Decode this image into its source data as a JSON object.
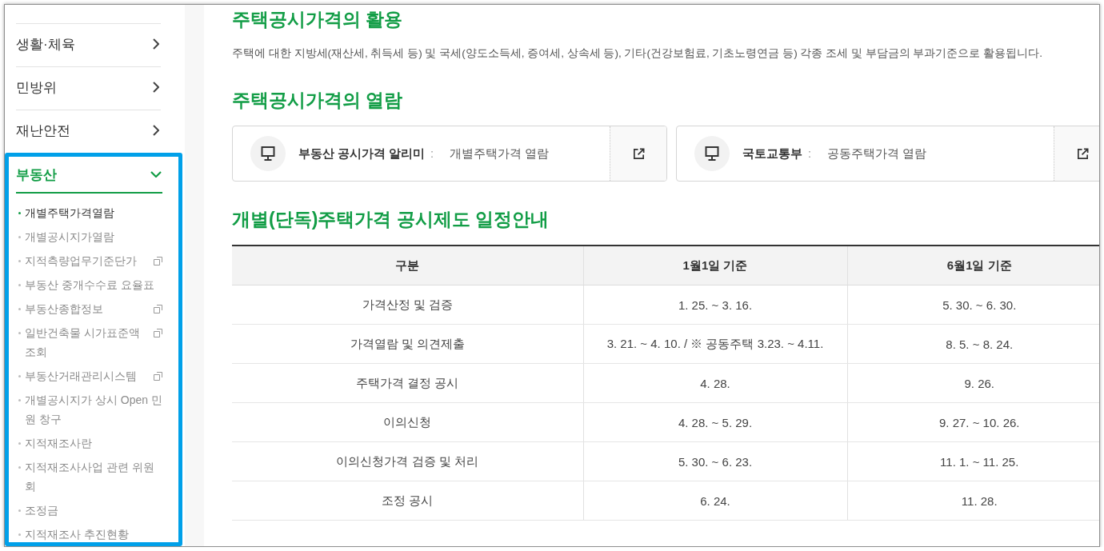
{
  "sidebar": {
    "items": [
      {
        "label": "생활·체육",
        "expanded": false,
        "highlighted": false
      },
      {
        "label": "민방위",
        "expanded": false,
        "highlighted": false
      },
      {
        "label": "재난안전",
        "expanded": false,
        "highlighted": false
      },
      {
        "label": "부동산",
        "expanded": true,
        "highlighted": true,
        "children": [
          {
            "label": "개별주택가격열람",
            "selected": true,
            "external": false
          },
          {
            "label": "개별공시지가열람",
            "selected": false,
            "external": false
          },
          {
            "label": "지적측량업무기준단가",
            "selected": false,
            "external": true
          },
          {
            "label": "부동산 중개수수료 요율표",
            "selected": false,
            "external": false
          },
          {
            "label": "부동산종합정보",
            "selected": false,
            "external": true
          },
          {
            "label": "일반건축물 시가표준액 조회",
            "selected": false,
            "external": true
          },
          {
            "label": "부동산거래관리시스템",
            "selected": false,
            "external": true
          },
          {
            "label": "개별공시지가 상시 Open 민원 창구",
            "selected": false,
            "external": false
          },
          {
            "label": "지적재조사란",
            "selected": false,
            "external": false
          },
          {
            "label": "지적재조사사업 관련 위원회",
            "selected": false,
            "external": false
          },
          {
            "label": "조정금",
            "selected": false,
            "external": false
          },
          {
            "label": "지적재조사 추진현황",
            "selected": false,
            "external": false
          }
        ]
      }
    ]
  },
  "sections": [
    {
      "kind": "text",
      "title": "주택공시가격의 활용",
      "body": "주택에 대한 지방세(재산세, 취득세 등) 및 국세(양도소득세, 증여세, 상속세 등), 기타(건강보험료, 기초노령연금 등) 각종 조세 및 부담금의 부과기준으로 활용됩니다."
    },
    {
      "kind": "links",
      "title": "주택공시가격의 열람",
      "links": [
        {
          "label": "부동산 공시가격 알리미",
          "separator": ":",
          "value": "개별주택가격 열람"
        },
        {
          "label": "국토교통부",
          "separator": ":",
          "value": "공동주택가격 열람"
        }
      ]
    },
    {
      "kind": "table",
      "title": "개별(단독)주택가격 공시제도 일정안내",
      "columns": [
        "구분",
        "1월1일 기준",
        "6월1일 기준"
      ],
      "rows": [
        [
          "가격산정 및 검증",
          "1. 25. ~ 3. 16.",
          "5. 30. ~ 6. 30."
        ],
        [
          "가격열람 및 의견제출",
          "3. 21. ~ 4. 10. / ※ 공동주택 3.23. ~ 4.11.",
          "8. 5. ~ 8. 24."
        ],
        [
          "주택가격 결정 공시",
          "4. 28.",
          "9. 26."
        ],
        [
          "이의신청",
          "4. 28. ~ 5. 29.",
          "9. 27. ~ 10. 26."
        ],
        [
          "이의신청가격 검증 및 처리",
          "5. 30. ~ 6. 23.",
          "11. 1. ~ 11. 25."
        ],
        [
          "조정 공시",
          "6. 24.",
          "11. 28."
        ]
      ]
    }
  ]
}
